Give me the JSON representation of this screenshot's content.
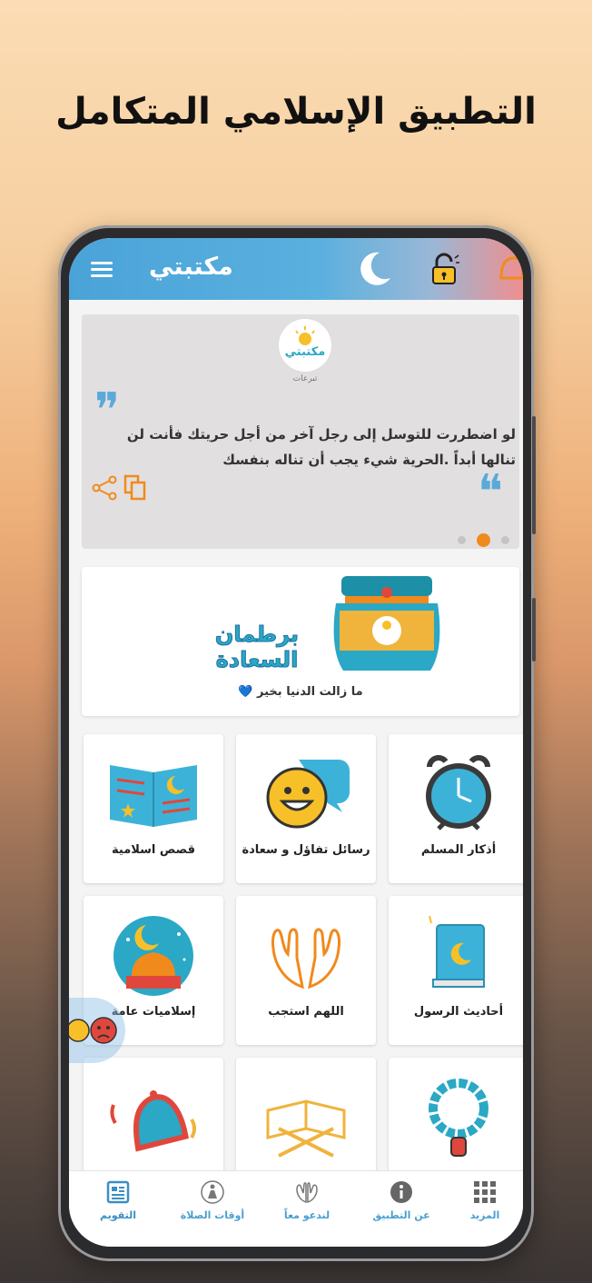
{
  "headline": "التطبيق الإسلامي المتكامل",
  "app": {
    "brand": "مكتبتي",
    "icons": {
      "menu": "hamburger-icon",
      "theme": "moon-icon",
      "lock": "unlocked-padlock-icon",
      "bell": "bell-icon"
    }
  },
  "quote": {
    "text": "لو اضطررت للتوسل إلى رجل آخر من أجل حريتك فأنت لن تنالها أبداً .الحرية شيء يجب أن تناله بنفسك",
    "logo_text": "مكتبتي",
    "logo_sub": "تبرعات",
    "pager": {
      "count": 3,
      "active": 1
    },
    "icons": {
      "share": "share-icon",
      "copy": "copy-icon",
      "open_quote": "quote-open-icon",
      "close_quote": "quote-close-icon"
    }
  },
  "banner": {
    "title": "برطمان السعادة",
    "caption": "ما زالت الدنيا بخير 💙"
  },
  "tiles": [
    {
      "label": "أذكار المسلم",
      "icon": "alarm-clock-icon"
    },
    {
      "label": "رسائل تفاؤل و سعادة",
      "icon": "smiley-chat-icon"
    },
    {
      "label": "قصص اسلامية",
      "icon": "open-book-icon"
    },
    {
      "label": "أحاديث الرسول",
      "icon": "quran-book-icon"
    },
    {
      "label": "اللهم استجب",
      "icon": "praying-hands-icon"
    },
    {
      "label": "إسلاميات عامة",
      "icon": "mosque-moon-icon"
    },
    {
      "label": "",
      "icon": "prayer-beads-icon"
    },
    {
      "label": "",
      "icon": "quran-stand-icon"
    },
    {
      "label": "",
      "icon": "ringing-bell-icon"
    }
  ],
  "bottom_nav": [
    {
      "label": "المزيد",
      "icon": "grid-icon"
    },
    {
      "label": "عن التطبيق",
      "icon": "info-icon"
    },
    {
      "label": "لندعو معاً",
      "icon": "dua-hands-icon"
    },
    {
      "label": "أوقات الصلاة",
      "icon": "prayer-person-icon"
    },
    {
      "label": "التقويم",
      "icon": "calendar-icon"
    }
  ],
  "colors": {
    "accent": "#4aa3d8",
    "orange": "#f08a1c",
    "teal": "#2aa8c5",
    "red_edge": "#ef8f8f"
  }
}
